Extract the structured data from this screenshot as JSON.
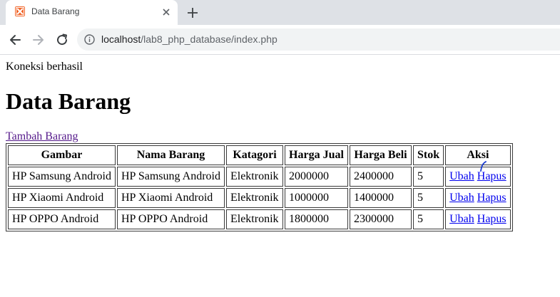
{
  "browser": {
    "tab_title": "Data Barang",
    "url_host": "localhost",
    "url_path": "/lab8_php_database/index.php",
    "icons": {
      "favicon": "xampp-favicon-icon",
      "close": "close-icon",
      "new_tab": "plus-icon",
      "back": "arrow-left-icon",
      "forward": "arrow-right-icon",
      "reload": "reload-icon",
      "site_info": "info-icon"
    }
  },
  "page": {
    "status": "Koneksi berhasil",
    "heading": "Data Barang",
    "add_link": "Tambah Barang",
    "table": {
      "headers": [
        "Gambar",
        "Nama Barang",
        "Katagori",
        "Harga Jual",
        "Harga Beli",
        "Stok",
        "Aksi"
      ],
      "rows": [
        {
          "gambar": "HP Samsung Android",
          "nama": "HP Samsung Android",
          "kategori": "Elektronik",
          "harga_jual": "2000000",
          "harga_beli": "2400000",
          "stok": "5",
          "ubah": "Ubah",
          "hapus": "Hapus"
        },
        {
          "gambar": "HP Xiaomi Android",
          "nama": "HP Xiaomi Android",
          "kategori": "Elektronik",
          "harga_jual": "1000000",
          "harga_beli": "1400000",
          "stok": "5",
          "ubah": "Ubah",
          "hapus": "Hapus"
        },
        {
          "gambar": "HP OPPO Android",
          "nama": "HP OPPO Android",
          "kategori": "Elektronik",
          "harga_jual": "1800000",
          "harga_beli": "2300000",
          "stok": "5",
          "ubah": "Ubah",
          "hapus": "Hapus"
        }
      ]
    }
  },
  "colors": {
    "tabstrip": "#dee1e6",
    "omnibox": "#f1f3f4",
    "favicon": "#f16529",
    "link": "#0000ee",
    "visited_link": "#551a8b",
    "cursor_mark": "#1a3ccf"
  }
}
